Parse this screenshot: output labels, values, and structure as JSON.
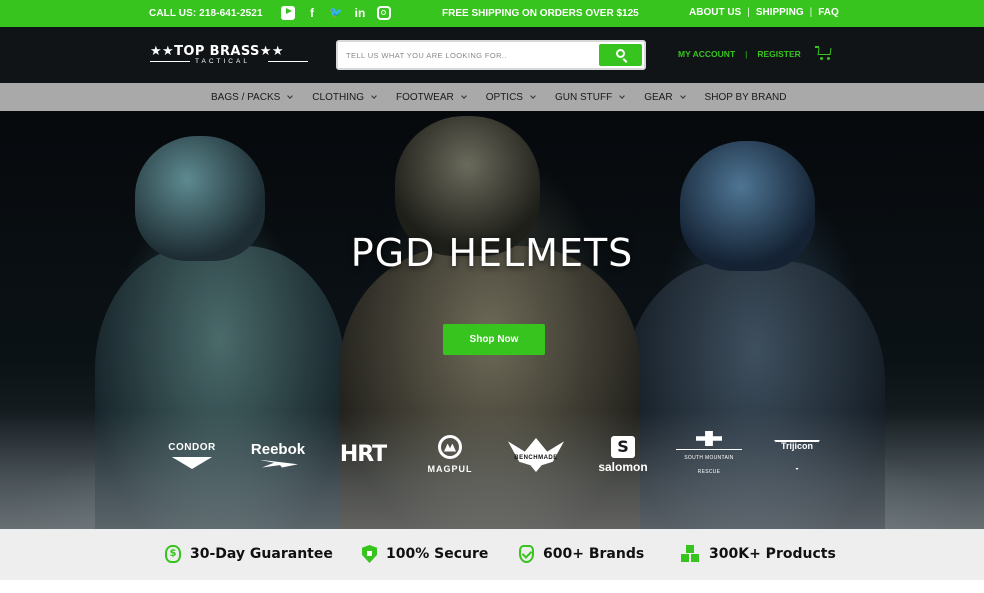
{
  "topbar": {
    "call": "CALL US: 218-641-2521",
    "socials": [
      {
        "icon": "youtube-icon"
      },
      {
        "icon": "facebook-icon",
        "glyph": "f"
      },
      {
        "icon": "twitter-icon",
        "glyph": "🐦"
      },
      {
        "icon": "linkedin-icon",
        "glyph": "in"
      },
      {
        "icon": "instagram-icon"
      }
    ],
    "shipping_message": "FREE SHIPPING ON ORDERS OVER $125",
    "links": [
      "ABOUT US",
      "SHIPPING",
      "FAQ"
    ],
    "separator": "|"
  },
  "header": {
    "logo": {
      "main": "★★TOP BRASS★★",
      "sub": "TACTICAL"
    },
    "search": {
      "placeholder": "TELL US WHAT YOU ARE LOOKING FOR..",
      "value": ""
    },
    "account": {
      "my_account": "MY ACCOUNT",
      "separator": "|",
      "register": "REGISTER"
    }
  },
  "nav": {
    "items": [
      {
        "label": "BAGS / PACKS",
        "dropdown": true
      },
      {
        "label": "CLOTHING",
        "dropdown": true
      },
      {
        "label": "FOOTWEAR",
        "dropdown": true
      },
      {
        "label": "OPTICS",
        "dropdown": true
      },
      {
        "label": "GUN STUFF",
        "dropdown": true
      },
      {
        "label": "GEAR",
        "dropdown": true
      },
      {
        "label": "SHOP BY BRAND",
        "dropdown": false
      }
    ]
  },
  "hero": {
    "title": "PGD HELMETS",
    "button": "Shop Now",
    "brands": {
      "condor": "CONDOR",
      "reebok": "Reebok",
      "hrt": "HRT",
      "magpul": "MAGPUL",
      "benchmade": "BENCHMADE",
      "salomon": "salomon",
      "smr": "SOUTH MOUNTAIN RESCUE",
      "trijicon": "Trijicon"
    }
  },
  "features": [
    {
      "icon": "money-bag-icon",
      "label": "30-Day Guarantee"
    },
    {
      "icon": "lock-shield-icon",
      "label": "100% Secure"
    },
    {
      "icon": "check-shield-icon",
      "label": "600+ Brands"
    },
    {
      "icon": "boxes-icon",
      "label": "300K+ Products"
    }
  ],
  "colors": {
    "accent": "#37c41e",
    "header_bg": "#111417",
    "nav_bg": "#a9a9a9",
    "features_bg": "#eeeeee"
  }
}
